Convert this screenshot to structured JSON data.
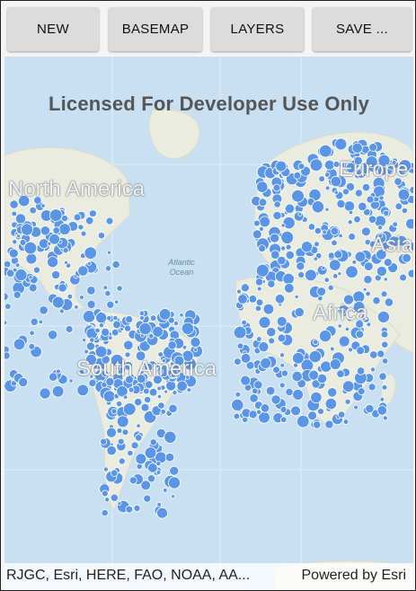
{
  "toolbar": {
    "new_label": "NEW",
    "basemap_label": "BASEMAP",
    "layers_label": "LAYERS",
    "save_label": "SAVE ..."
  },
  "map": {
    "watermark": "Licensed For Developer Use Only",
    "labels": {
      "north_america": "North America",
      "south_america": "South America",
      "europe": "Europe",
      "asia": "Asia",
      "africa": "Africa",
      "atlantic_ocean": "Atlantic\nOcean"
    },
    "attribution": "RJGC, Esri, HERE, FAO, NOAA, AA...",
    "powered_by": "Powered by Esri",
    "colors": {
      "water": "#c8e0f2",
      "land": "#e9ecde",
      "marker": "#5b95e6",
      "marker_stroke": "#ffffff"
    }
  }
}
